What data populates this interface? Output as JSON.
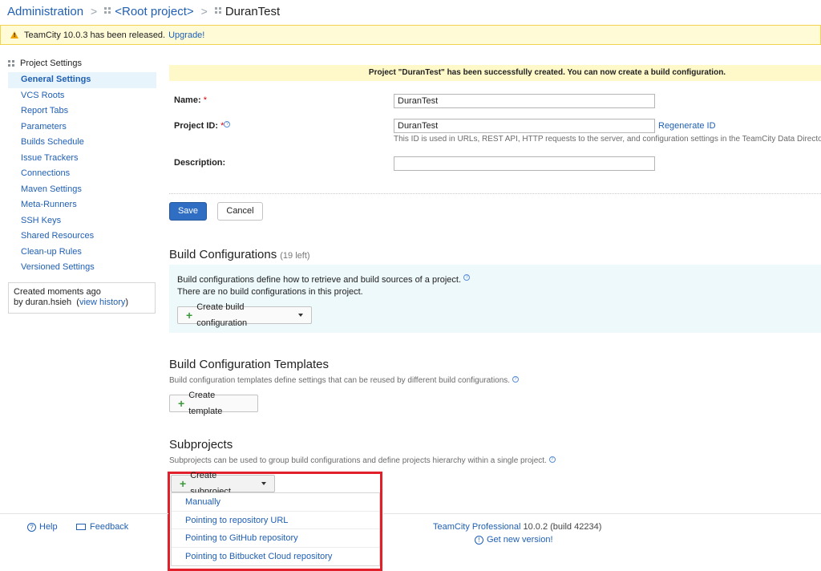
{
  "breadcrumb": {
    "admin": "Administration",
    "root": "<Root project>",
    "current": "DuranTest",
    "separator": ">"
  },
  "banner": {
    "text": "TeamCity 10.0.3 has been released.",
    "link": "Upgrade!",
    "warn_glyph": "!"
  },
  "sidebar": {
    "title": "Project Settings",
    "items": [
      {
        "label": "General Settings",
        "active": true
      },
      {
        "label": "VCS Roots"
      },
      {
        "label": "Report Tabs"
      },
      {
        "label": "Parameters"
      },
      {
        "label": "Builds Schedule"
      },
      {
        "label": "Issue Trackers"
      },
      {
        "label": "Connections"
      },
      {
        "label": "Maven Settings"
      },
      {
        "label": "Meta-Runners"
      },
      {
        "label": "SSH Keys"
      },
      {
        "label": "Shared Resources"
      },
      {
        "label": "Clean-up Rules"
      },
      {
        "label": "Versioned Settings"
      }
    ],
    "history": {
      "created": "Created moments ago",
      "by": "by duran.hsieh",
      "link": "view history"
    }
  },
  "success_message": "Project \"DuranTest\" has been successfully created. You can now create a build configuration.",
  "form": {
    "name_label": "Name:",
    "name_value": "DuranTest",
    "id_label": "Project ID:",
    "id_value": "DuranTest",
    "regenerate": "Regenerate ID",
    "id_note": "This ID is used in URLs, REST API, HTTP requests to the server, and configuration settings in the TeamCity Data Directory.",
    "description_label": "Description:",
    "description_value": "",
    "required_mark": "*",
    "help_glyph": "?"
  },
  "buttons": {
    "save": "Save",
    "cancel": "Cancel"
  },
  "build_configs": {
    "title": "Build Configurations",
    "left": "(19 left)",
    "desc1": "Build configurations define how to retrieve and build sources of a project.",
    "desc2": "There are no build configurations in this project.",
    "create": "Create build configuration"
  },
  "templates": {
    "title": "Build Configuration Templates",
    "desc": "Build configuration templates define settings that can be reused by different build configurations.",
    "create": "Create template"
  },
  "subprojects": {
    "title": "Subprojects",
    "desc": "Subprojects can be used to group build configurations and define projects hierarchy within a single project.",
    "create": "Create subproject",
    "menu": [
      "Manually",
      "Pointing to repository URL",
      "Pointing to GitHub repository",
      "Pointing to Bitbucket Cloud repository"
    ]
  },
  "footer": {
    "help": "Help",
    "feedback": "Feedback",
    "product": "TeamCity Professional",
    "version": "10.0.2 (build 42234)",
    "new_version": "Get new version!",
    "help_glyph": "?",
    "info_glyph": "!"
  },
  "colors": {
    "accent": "#1f5fb4",
    "highlight_border": "#e2202c",
    "save_button": "#2f6ec3"
  }
}
